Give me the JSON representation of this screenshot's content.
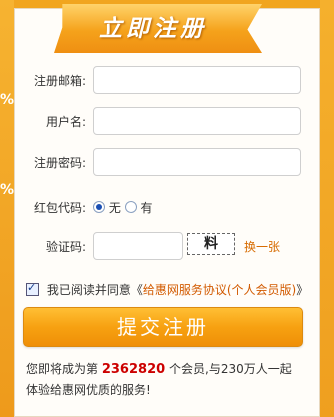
{
  "ribbon": {
    "title": "立即注册"
  },
  "side": {
    "pct1": "%",
    "pct2": "%"
  },
  "form": {
    "email_label": "注册邮箱:",
    "username_label": "用户名:",
    "password_label": "注册密码:",
    "redpacket_label": "红包代码:",
    "redpacket_options": [
      "无",
      "有"
    ],
    "captcha_label": "验证码:",
    "captcha_text": "料",
    "refresh_label": "换一张"
  },
  "agreement": {
    "prefix": "我已阅读并同意《",
    "link_text": "给惠网服务协议(个人会员版)",
    "suffix": "》"
  },
  "submit_label": "提交注册",
  "stats": {
    "prefix": "您即将成为第",
    "member_number": "2362820",
    "middle": "个会员,与230万人一起体验给惠网优质的服务!"
  }
}
